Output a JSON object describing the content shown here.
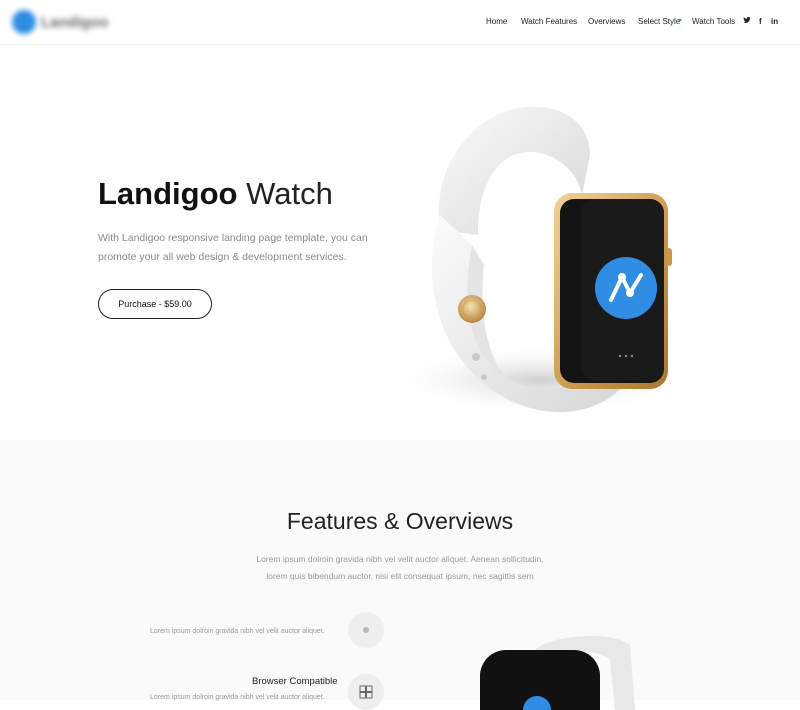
{
  "header": {
    "logo_text": "Landigoo",
    "nav": [
      "Home",
      "Watch Features",
      "Overviews",
      "Select Style",
      "Watch Tools"
    ],
    "social": [
      "twitter-icon",
      "facebook-icon",
      "linkedin-icon"
    ],
    "social_glyphs": [
      "🐦",
      "f",
      "in"
    ]
  },
  "hero": {
    "title_bold": "Landigoo",
    "title_light": "Watch",
    "description": "With Landigoo responsive landing page template, you can promote your all web design & development services.",
    "button_label": "Purchase - $59.00"
  },
  "features": {
    "title": "Features & Overviews",
    "subtitle_line1": "Lorem ipsum dolroin gravida nibh vel velit auctor aliquet. Aenean sollicitudin,",
    "subtitle_line2": "lorem quis bibendum auctor, nisi elit consequat ipsum, nec sagittis sem",
    "items": [
      {
        "title": "",
        "description": "Lorem ipsum dolroin gravida nibh vel velit auctor aliquet."
      },
      {
        "title": "Browser Compatible",
        "description": "Lorem ipsum dolroin gravida nibh vel velit auctor aliquet."
      }
    ]
  },
  "colors": {
    "accent": "#2f8de4",
    "gold": "#d9a655"
  }
}
